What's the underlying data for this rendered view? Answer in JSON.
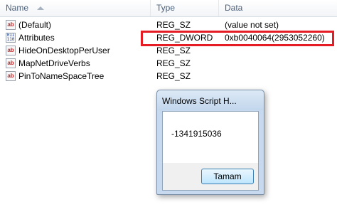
{
  "columns": {
    "name": "Name",
    "type": "Type",
    "data": "Data"
  },
  "rows": [
    {
      "icon": "string-value-icon",
      "icon_text": "ab",
      "name": "(Default)",
      "type": "REG_SZ",
      "data": "(value not set)"
    },
    {
      "icon": "binary-value-icon",
      "icon_text": "011\n110",
      "name": "Attributes",
      "type": "REG_DWORD",
      "data": "0xb0040064(2953052260)"
    },
    {
      "icon": "string-value-icon",
      "icon_text": "ab",
      "name": "HideOnDesktopPerUser",
      "type": "REG_SZ",
      "data": ""
    },
    {
      "icon": "string-value-icon",
      "icon_text": "ab",
      "name": "MapNetDriveVerbs",
      "type": "REG_SZ",
      "data": ""
    },
    {
      "icon": "string-value-icon",
      "icon_text": "ab",
      "name": "PinToNameSpaceTree",
      "type": "REG_SZ",
      "data": ""
    }
  ],
  "highlight_color": "#e51c24",
  "dialog": {
    "title": "Windows Script H...",
    "message": "-1341915036",
    "ok_label": "Tamam"
  }
}
